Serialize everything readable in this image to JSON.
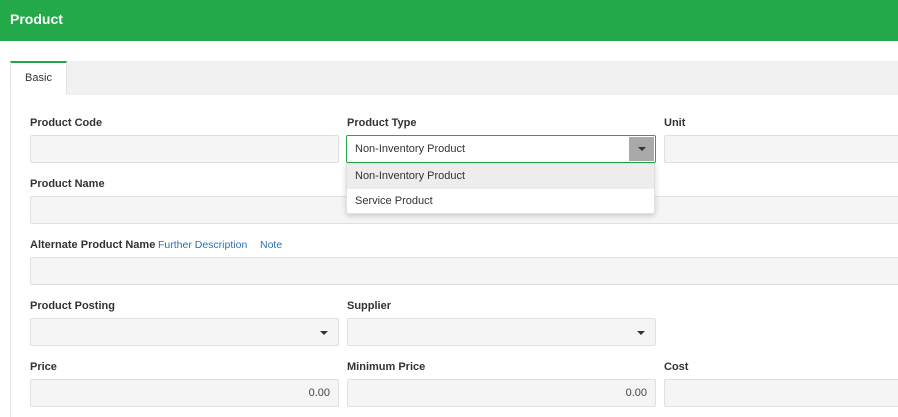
{
  "header": {
    "title": "Product",
    "bg_color": "#23a84a"
  },
  "tabs": [
    {
      "label": "Basic",
      "active": true
    }
  ],
  "form": {
    "product_code": {
      "label": "Product Code",
      "value": ""
    },
    "product_type": {
      "label": "Product Type",
      "value": "Non-Inventory Product",
      "options": [
        "Non-Inventory Product",
        "Service Product"
      ],
      "highlighted_option": "Non-Inventory Product",
      "expanded": true
    },
    "unit": {
      "label": "Unit",
      "value": ""
    },
    "product_name": {
      "label": "Product Name",
      "value": ""
    },
    "alternate_product_name": {
      "label": "Alternate Product Name",
      "value": ""
    },
    "links": {
      "further_description": "Further Description",
      "note": "Note"
    },
    "product_posting": {
      "label": "Product Posting",
      "value": ""
    },
    "supplier": {
      "label": "Supplier",
      "value": ""
    },
    "price": {
      "label": "Price",
      "value": "0.00"
    },
    "minimum_price": {
      "label": "Minimum Price",
      "value": "0.00"
    },
    "cost": {
      "label": "Cost",
      "value": ""
    }
  },
  "icons": {
    "dropdown_caret": "chevron-down-icon"
  },
  "colors": {
    "accent": "#23a84a",
    "link": "#2f6fb5",
    "field_bg": "#f5f5f5"
  }
}
